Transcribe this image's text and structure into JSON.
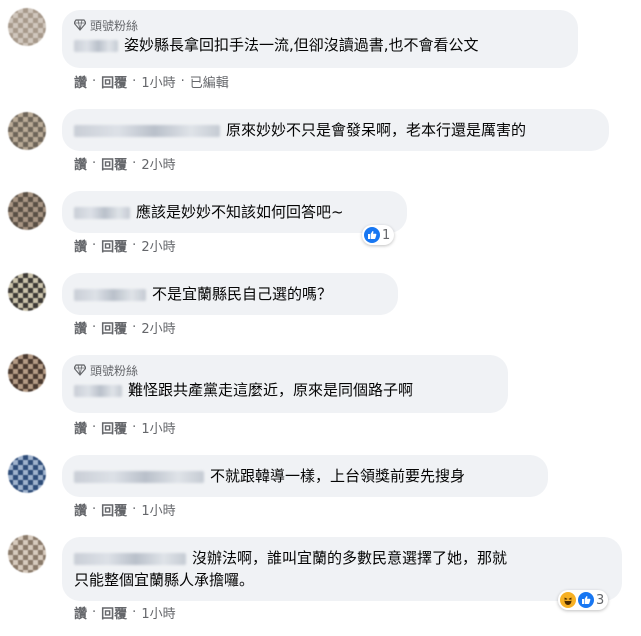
{
  "badge_label": "頭號粉絲",
  "actions": {
    "like": "讚",
    "reply": "回覆",
    "separator": "·"
  },
  "colors": {
    "like_blue": "#1877f2",
    "haha_yellow": "#f7b125",
    "bubble_bg": "#f0f2f5",
    "meta_gray": "#65676b"
  },
  "comments": [
    {
      "badge": true,
      "text": "姿妙縣長拿回扣手法一流,但卻沒讀過書,也不會看公文",
      "time": "1小時",
      "edited": "已編輯"
    },
    {
      "badge": false,
      "text": "原來妙妙不只是會發呆啊，老本行還是厲害的",
      "time": "2小時"
    },
    {
      "badge": false,
      "text": "應該是妙妙不知該如何回答吧~",
      "time": "2小時",
      "reaction_icon": "like-icon",
      "reaction_count": "1"
    },
    {
      "badge": false,
      "text": "不是宜蘭縣民自己選的嗎？",
      "time": "2小時"
    },
    {
      "badge": true,
      "text": "難怪跟共產黨走這麼近，原來是同個路子啊",
      "time": "1小時"
    },
    {
      "badge": false,
      "text": "不就跟韓導一樣，上台領獎前要先搜身",
      "time": "1小時"
    },
    {
      "badge": false,
      "text_line1": "沒辦法啊，誰叫宜蘭的多數民意選擇了她，那就",
      "text_line2": "只能整個宜蘭縣人承擔囉。",
      "time": "1小時",
      "reaction_icons": [
        "haha-icon",
        "like-icon"
      ],
      "reaction_count": "3"
    }
  ]
}
